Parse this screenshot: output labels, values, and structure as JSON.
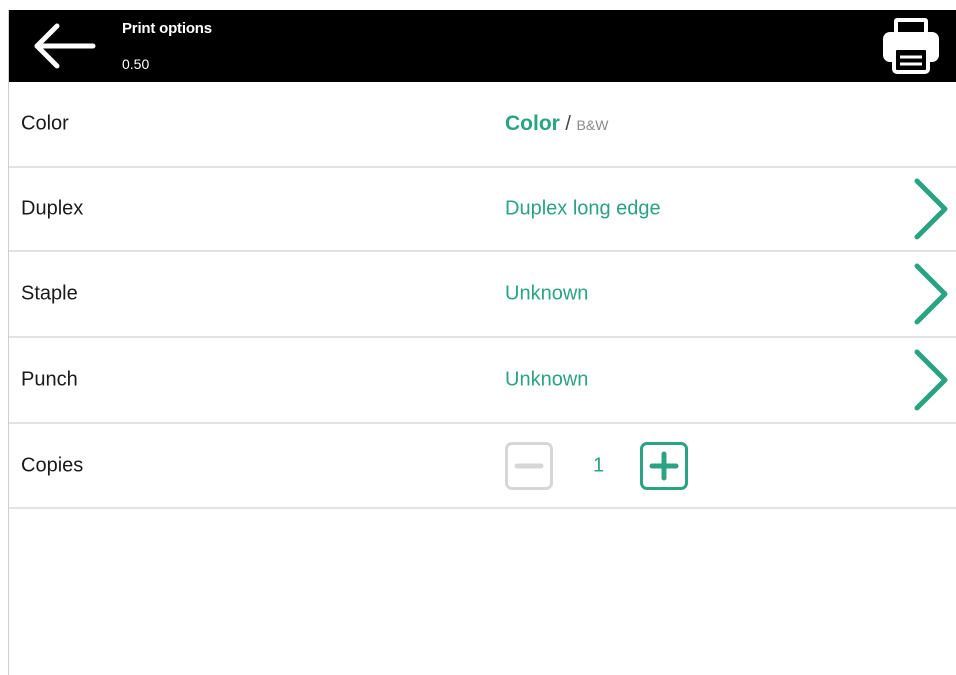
{
  "header": {
    "title": "Print options",
    "subtitle": "0.50",
    "back_icon": "arrow-left-icon",
    "print_icon": "printer-icon",
    "background": "#000000"
  },
  "options": {
    "color": {
      "label": "Color",
      "selected": "Color",
      "separator": "/",
      "alternative": "B&W"
    },
    "duplex": {
      "label": "Duplex",
      "value": "Duplex long edge"
    },
    "staple": {
      "label": "Staple",
      "value": "Unknown"
    },
    "punch": {
      "label": "Punch",
      "value": "Unknown"
    },
    "copies": {
      "label": "Copies",
      "count": "1"
    }
  },
  "colors": {
    "accent": "#2aa383",
    "disabled": "#d6d6d6",
    "divider": "#e2e2e2"
  }
}
